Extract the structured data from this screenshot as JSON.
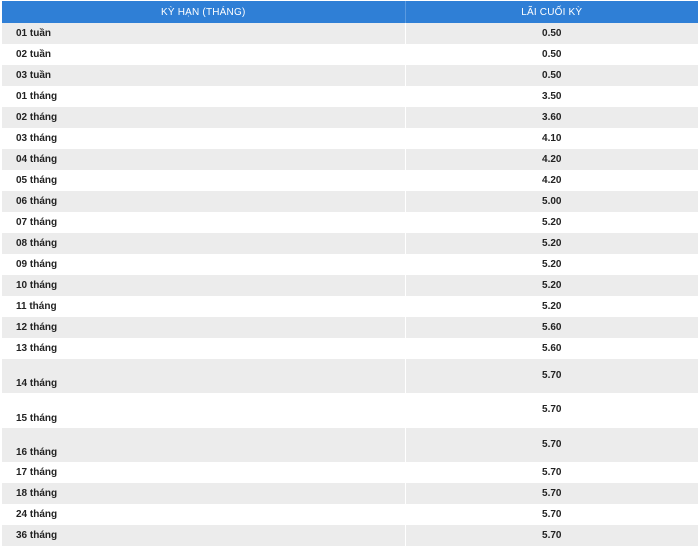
{
  "table": {
    "headers": {
      "term": "KỲ HẠN (THÁNG)",
      "rate": "LÃI CUỐI KỲ"
    },
    "rows": [
      {
        "term": "01 tuần",
        "rate": "0.50"
      },
      {
        "term": "02 tuần",
        "rate": "0.50"
      },
      {
        "term": "03 tuần",
        "rate": "0.50"
      },
      {
        "term": "01 tháng",
        "rate": "3.50"
      },
      {
        "term": "02 tháng",
        "rate": "3.60"
      },
      {
        "term": "03 tháng",
        "rate": "4.10"
      },
      {
        "term": "04 tháng",
        "rate": "4.20"
      },
      {
        "term": "05 tháng",
        "rate": "4.20"
      },
      {
        "term": "06 tháng",
        "rate": "5.00"
      },
      {
        "term": "07 tháng",
        "rate": "5.20"
      },
      {
        "term": "08 tháng",
        "rate": "5.20"
      },
      {
        "term": "09 tháng",
        "rate": "5.20"
      },
      {
        "term": "10 tháng",
        "rate": "5.20"
      },
      {
        "term": "11 tháng",
        "rate": "5.20"
      },
      {
        "term": "12 tháng",
        "rate": "5.60"
      },
      {
        "term": "13 tháng",
        "rate": "5.60"
      },
      {
        "term": "14 tháng",
        "rate": "5.70"
      },
      {
        "term": "15 tháng",
        "rate": "5.70"
      },
      {
        "term": "16 tháng",
        "rate": "5.70"
      },
      {
        "term": "17 tháng",
        "rate": "5.70"
      },
      {
        "term": "18 tháng",
        "rate": "5.70"
      },
      {
        "term": "24 tháng",
        "rate": "5.70"
      },
      {
        "term": "36 tháng",
        "rate": "5.70"
      }
    ]
  },
  "colors": {
    "header_bg": "#2f7fd6",
    "stripe": "#ececec"
  }
}
